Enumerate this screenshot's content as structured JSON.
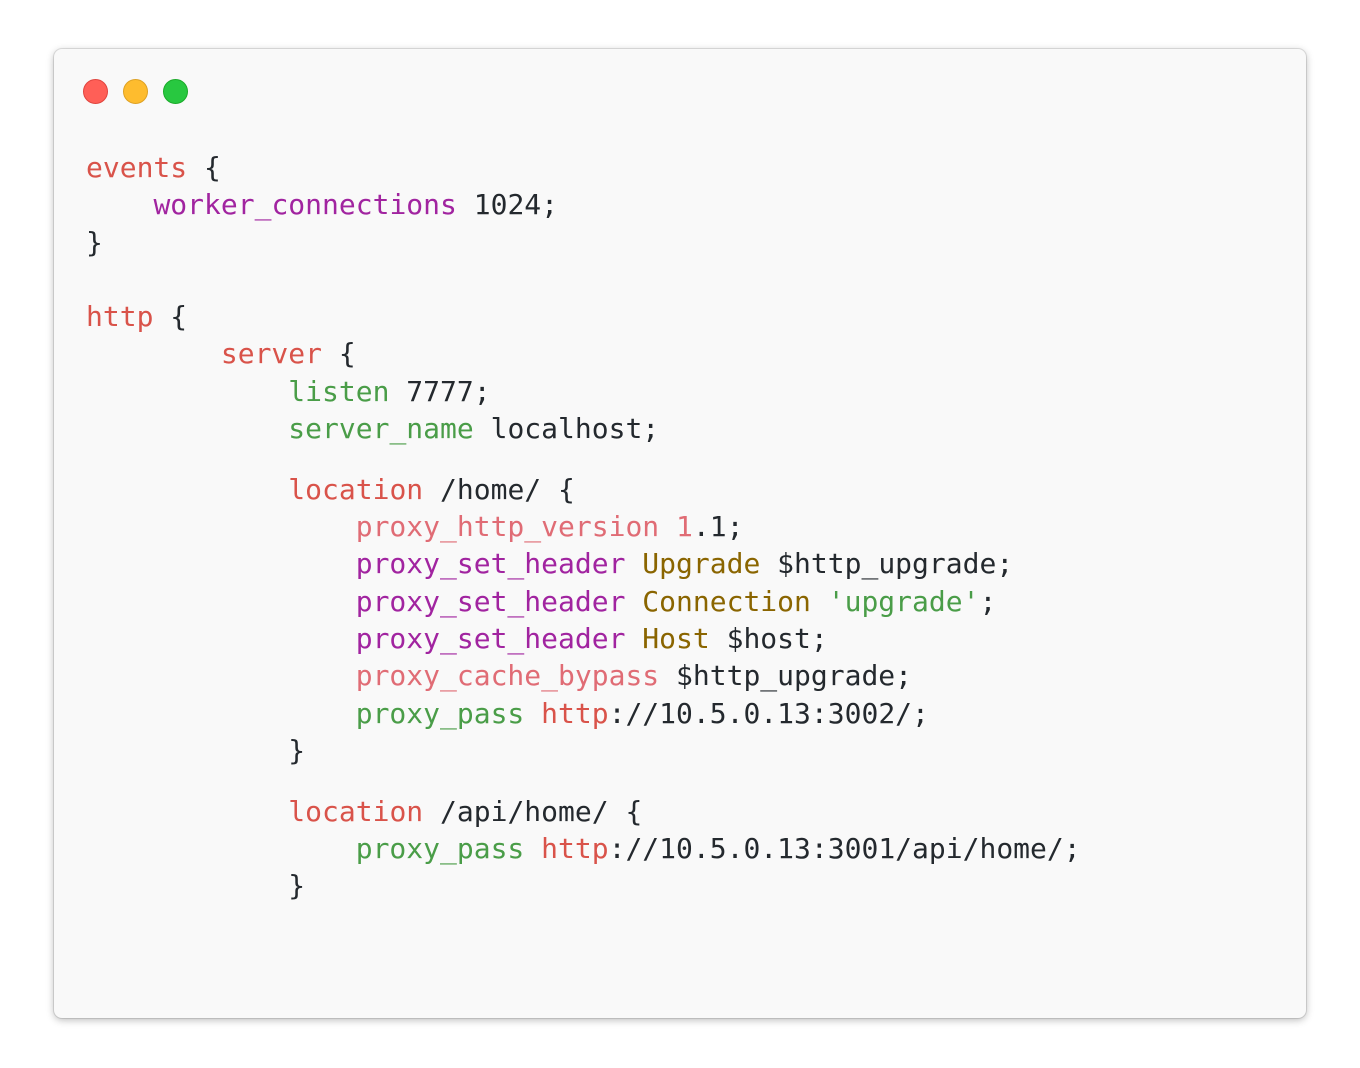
{
  "window": {
    "controls": [
      {
        "name": "close",
        "color": "#ff5f57",
        "border": "#e0443e"
      },
      {
        "name": "minimize",
        "color": "#febc2e",
        "border": "#dea123"
      },
      {
        "name": "maximize",
        "color": "#28c840",
        "border": "#1aab29"
      }
    ]
  },
  "code": {
    "language": "nginx",
    "lines": [
      {
        "indent": "",
        "tokens": [
          {
            "t": "events",
            "c": "kw"
          },
          {
            "t": " {",
            "c": "plain"
          }
        ]
      },
      {
        "indent": "    ",
        "tokens": [
          {
            "t": "worker_connections",
            "c": "dir"
          },
          {
            "t": " 1024;",
            "c": "plain"
          }
        ]
      },
      {
        "indent": "",
        "tokens": [
          {
            "t": "}",
            "c": "plain"
          }
        ]
      },
      {
        "indent": "",
        "tokens": []
      },
      {
        "indent": "",
        "tokens": [
          {
            "t": "http",
            "c": "kw"
          },
          {
            "t": " {",
            "c": "plain"
          }
        ]
      },
      {
        "indent": "        ",
        "tokens": [
          {
            "t": "server",
            "c": "kw"
          },
          {
            "t": " {",
            "c": "plain"
          }
        ]
      },
      {
        "indent": "            ",
        "tokens": [
          {
            "t": "listen",
            "c": "prop"
          },
          {
            "t": " 7777;",
            "c": "plain"
          }
        ]
      },
      {
        "indent": "            ",
        "tokens": [
          {
            "t": "server_name",
            "c": "prop"
          },
          {
            "t": " localhost;",
            "c": "plain"
          }
        ]
      },
      {
        "indent": "",
        "tokens": [],
        "half": true
      },
      {
        "indent": "            ",
        "tokens": [
          {
            "t": "location",
            "c": "kw"
          },
          {
            "t": " /home/ {",
            "c": "plain"
          }
        ]
      },
      {
        "indent": "                ",
        "tokens": [
          {
            "t": "proxy_http_version",
            "c": "soft"
          },
          {
            "t": " ",
            "c": "plain"
          },
          {
            "t": "1",
            "c": "soft"
          },
          {
            "t": ".1;",
            "c": "plain"
          }
        ]
      },
      {
        "indent": "                ",
        "tokens": [
          {
            "t": "proxy_set_header",
            "c": "dir"
          },
          {
            "t": " ",
            "c": "plain"
          },
          {
            "t": "Upgrade",
            "c": "hdr"
          },
          {
            "t": " $http_upgrade;",
            "c": "plain"
          }
        ]
      },
      {
        "indent": "                ",
        "tokens": [
          {
            "t": "proxy_set_header",
            "c": "dir"
          },
          {
            "t": " ",
            "c": "plain"
          },
          {
            "t": "Connection",
            "c": "hdr"
          },
          {
            "t": " ",
            "c": "plain"
          },
          {
            "t": "'upgrade'",
            "c": "str"
          },
          {
            "t": ";",
            "c": "plain"
          }
        ]
      },
      {
        "indent": "                ",
        "tokens": [
          {
            "t": "proxy_set_header",
            "c": "dir"
          },
          {
            "t": " ",
            "c": "plain"
          },
          {
            "t": "Host",
            "c": "hdr"
          },
          {
            "t": " $host;",
            "c": "plain"
          }
        ]
      },
      {
        "indent": "                ",
        "tokens": [
          {
            "t": "proxy_cache_bypass",
            "c": "soft"
          },
          {
            "t": " $http_upgrade;",
            "c": "plain"
          }
        ]
      },
      {
        "indent": "                ",
        "tokens": [
          {
            "t": "proxy_pass",
            "c": "prop"
          },
          {
            "t": " ",
            "c": "plain"
          },
          {
            "t": "http",
            "c": "kw"
          },
          {
            "t": "://10.5.0.13:3002/;",
            "c": "plain"
          }
        ]
      },
      {
        "indent": "            ",
        "tokens": [
          {
            "t": "}",
            "c": "plain"
          }
        ]
      },
      {
        "indent": "",
        "tokens": [],
        "half": true
      },
      {
        "indent": "            ",
        "tokens": [
          {
            "t": "location",
            "c": "kw"
          },
          {
            "t": " /api/home/ {",
            "c": "plain"
          }
        ]
      },
      {
        "indent": "                ",
        "tokens": [
          {
            "t": "proxy_pass",
            "c": "prop"
          },
          {
            "t": " ",
            "c": "plain"
          },
          {
            "t": "http",
            "c": "kw"
          },
          {
            "t": "://10.5.0.13:3001/api/home/;",
            "c": "plain"
          }
        ]
      },
      {
        "indent": "            ",
        "tokens": [
          {
            "t": "}",
            "c": "plain"
          }
        ]
      }
    ]
  }
}
